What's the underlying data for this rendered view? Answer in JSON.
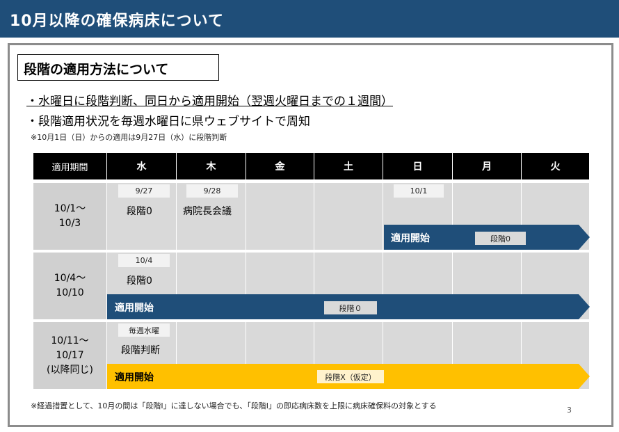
{
  "header": {
    "title": "10月以降の確保病床について"
  },
  "section": {
    "title": "段階の適用方法について"
  },
  "bullets": [
    "・水曜日に段階判断、同日から適用開始（翌週火曜日までの１週間）",
    "・段階適用状況を毎週水曜日に県ウェブサイトで周知"
  ],
  "note": "※10月1日（日）からの適用は9月27日（水）に段階判断",
  "table": {
    "headers": [
      "適用期間",
      "水",
      "木",
      "金",
      "土",
      "日",
      "月",
      "火"
    ],
    "rows": [
      {
        "period": [
          "10/1～",
          "10/3"
        ],
        "tags": {
          "wed": "9/27",
          "thu": "9/28",
          "sun": "10/1"
        },
        "texts": {
          "wed": "段階0",
          "thu": "病院長会議"
        },
        "arrow_label": "適用開始",
        "arrow_tag": "段階0"
      },
      {
        "period": [
          "10/4～",
          "10/10"
        ],
        "tags": {
          "wed": "10/4"
        },
        "texts": {
          "wed": "段階0"
        },
        "arrow_label": "適用開始",
        "arrow_tag": "段階０"
      },
      {
        "period": [
          "10/11～",
          "10/17",
          "(以降同じ)"
        ],
        "tags": {
          "wed": "毎週水曜"
        },
        "texts": {
          "wed": "段階判断"
        },
        "arrow_label": "適用開始",
        "arrow_tag": "段階X（仮定）"
      }
    ]
  },
  "footnote": "※経過措置として、10月の間は「段階Ⅰ」に達しない場合でも、「段階Ⅰ」の即応病床数を上限に病床確保料の対象とする",
  "page_number": "3",
  "colors": {
    "header_bg": "#1f4e79",
    "arrow_blue": "#1f4e79",
    "arrow_yellow": "#ffc000",
    "table_header_bg": "#000000",
    "cell_bg": "#d9d9d9"
  }
}
